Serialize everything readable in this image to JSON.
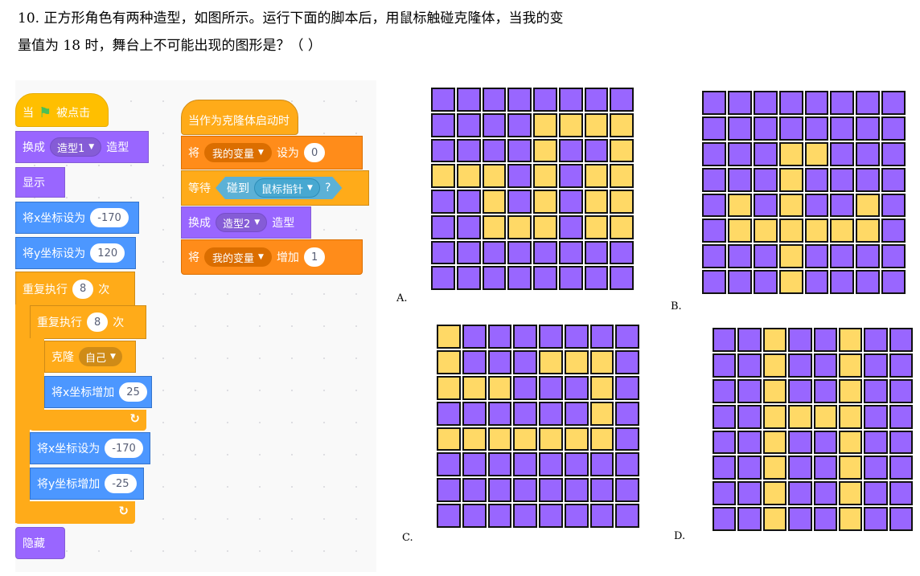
{
  "question": {
    "line1": "10. 正方形角色有两种造型，如图所示。运行下面的脚本后，用鼠标触碰克隆体，当我的变",
    "line2": "量值为 18 时，舞台上不可能出现的图形是？（  ）"
  },
  "colors": {
    "purple": "#9966ff",
    "yellow": "#ffd966"
  },
  "script1": {
    "hat_when": "当",
    "hat_flag_icon": "green-flag-icon",
    "hat_clicked": "被点击",
    "switch_label": "换成",
    "switch_costume": "造型1",
    "switch_suffix": "造型",
    "show": "显示",
    "set_x_label": "将x坐标设为",
    "set_x_value": "-170",
    "set_y_label": "将y坐标设为",
    "set_y_value": "120",
    "repeat_label": "重复执行",
    "repeat_value": "8",
    "repeat_suffix": "次",
    "inner_repeat_label": "重复执行",
    "inner_repeat_value": "8",
    "inner_repeat_suffix": "次",
    "clone_label": "克隆",
    "clone_target": "自己",
    "change_x_label": "将x坐标增加",
    "change_x_value": "25",
    "reset_x_label": "将x坐标设为",
    "reset_x_value": "-170",
    "change_y_label": "将y坐标增加",
    "change_y_value": "-25",
    "hide": "隐藏"
  },
  "script2": {
    "hat": "当作为克隆体启动时",
    "set_label": "将",
    "set_var": "我的变量",
    "set_to": "设为",
    "set_value": "0",
    "wait_label": "等待",
    "touching_label": "碰到",
    "touching_target": "鼠标指针",
    "touching_q": "?",
    "switch_label": "换成",
    "switch_costume": "造型2",
    "switch_suffix": "造型",
    "change_label": "将",
    "change_var": "我的变量",
    "change_by": "增加",
    "change_value": "1"
  },
  "options": [
    {
      "label": "A.",
      "grid": [
        "00000000",
        "00001111",
        "00001001",
        "11101011",
        "00101011",
        "00111011",
        "00000000",
        "00000000"
      ]
    },
    {
      "label": "B.",
      "grid": [
        "00000000",
        "00000000",
        "00011000",
        "00010000",
        "01010010",
        "01111110",
        "00010000",
        "00010000"
      ]
    },
    {
      "label": "C.",
      "grid": [
        "10000000",
        "10001110",
        "11100010",
        "00000010",
        "11111110",
        "00000000",
        "00000000",
        "00000000"
      ]
    },
    {
      "label": "D.",
      "grid": [
        "00100100",
        "00100100",
        "00100100",
        "00111100",
        "00100100",
        "00100100",
        "00100100",
        "00100100"
      ]
    }
  ]
}
